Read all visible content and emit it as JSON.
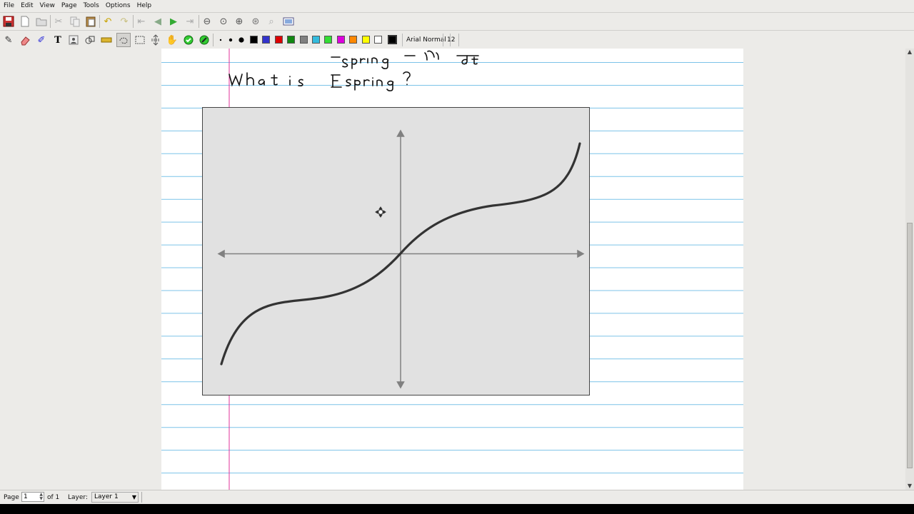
{
  "menu": {
    "file": "File",
    "edit": "Edit",
    "view": "View",
    "page": "Page",
    "tools": "Tools",
    "options": "Options",
    "help": "Help"
  },
  "toolbar2": {
    "font_name": "Arial Normal",
    "font_size": "12",
    "colors": [
      "#000000",
      "#3333cc",
      "#dd0000",
      "#118811",
      "#808080",
      "#33bbdd",
      "#33dd33",
      "#dd00dd",
      "#ff8800",
      "#ffff00",
      "#ffffff"
    ],
    "current_color": "#000000"
  },
  "handwriting": {
    "line1": "Fspring = m d/dt",
    "line2": "What is Fspring ?"
  },
  "chart_data": {
    "type": "line",
    "grid": false,
    "series": [
      {
        "shape": "cubic through origin, increasing"
      }
    ]
  },
  "statusbar": {
    "page_label": "Page",
    "page_value": "1",
    "of_label": "of 1",
    "layer_label": "Layer:",
    "layer_value": "Layer 1"
  }
}
